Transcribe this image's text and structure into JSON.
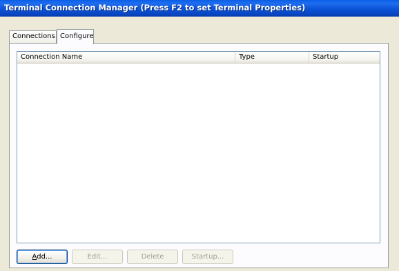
{
  "window": {
    "title": "Terminal Connection Manager (Press F2 to set Terminal Properties)"
  },
  "tabs": [
    {
      "label": "Connections",
      "active": false
    },
    {
      "label": "Configure",
      "active": true
    }
  ],
  "listview": {
    "columns": [
      "Connection Name",
      "Type",
      "Startup"
    ],
    "rows": []
  },
  "buttons": {
    "add": {
      "prefix": "A",
      "rest": "dd...",
      "enabled": true,
      "default": true
    },
    "edit": {
      "label": "Edit...",
      "enabled": false
    },
    "delete": {
      "label": "Delete",
      "enabled": false
    },
    "startup": {
      "label": "Startup...",
      "enabled": false
    }
  },
  "colors": {
    "titlebar": "#0B52D6",
    "face": "#ECE9D8",
    "disabled_text": "#A19F92"
  }
}
